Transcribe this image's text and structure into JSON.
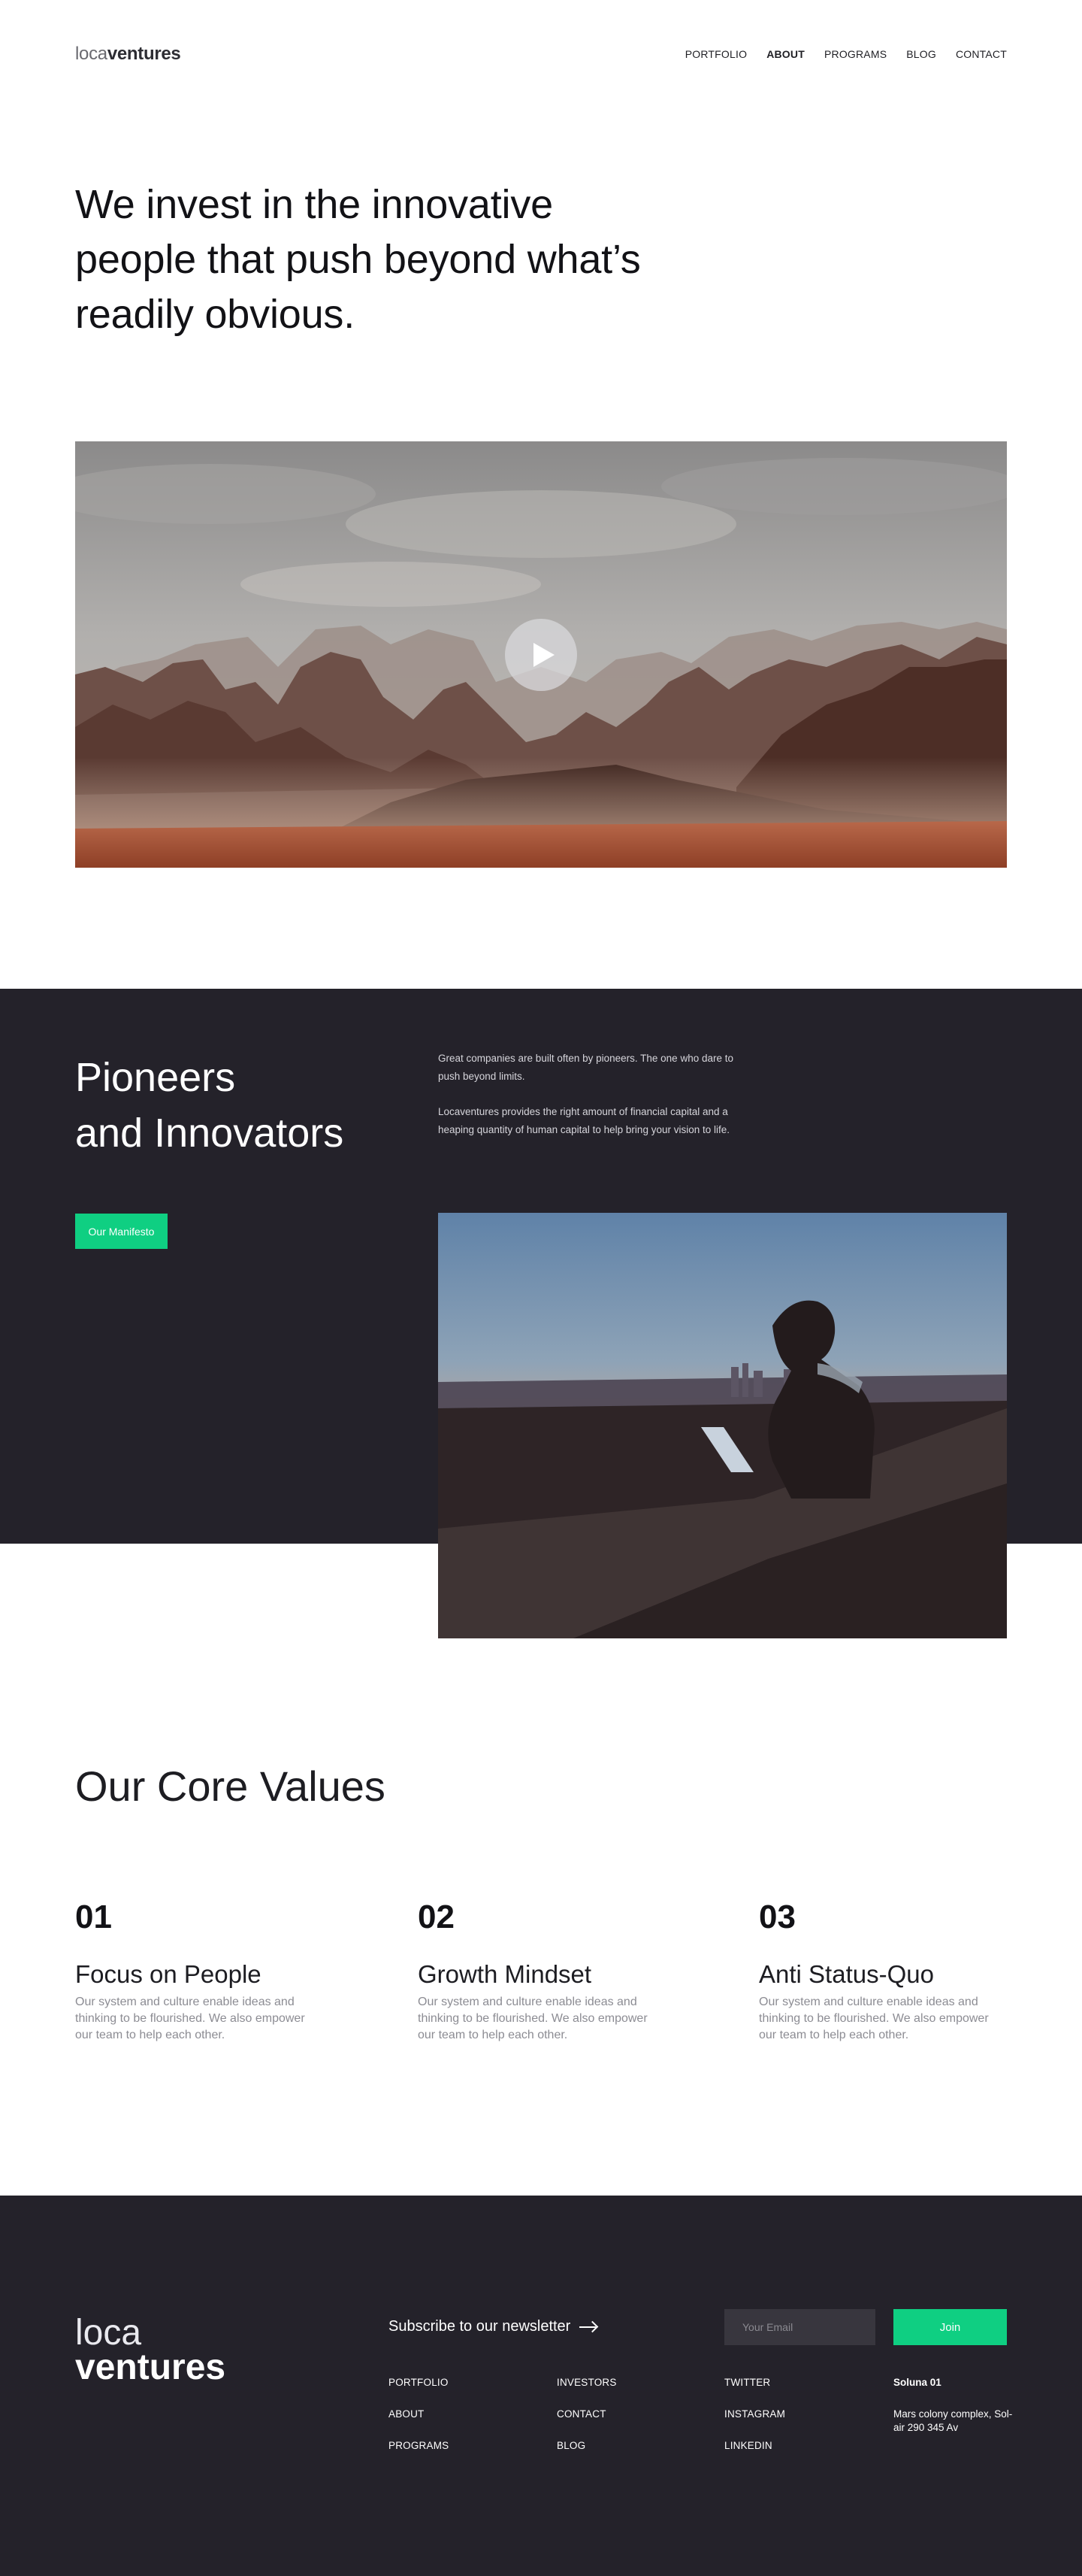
{
  "header": {
    "logo_light": "loca",
    "logo_bold": "ventures",
    "nav": [
      {
        "label": "PORTFOLIO"
      },
      {
        "label": "ABOUT"
      },
      {
        "label": "PROGRAMS"
      },
      {
        "label": "BLOG"
      },
      {
        "label": "CONTACT"
      }
    ],
    "active_nav": "ABOUT"
  },
  "hero": {
    "title": "We invest in the innovative people that push beyond what’s readily obvious.",
    "video_icon": "play-icon"
  },
  "pioneers": {
    "title_line1": "Pioneers",
    "title_line2": "and Innovators",
    "paragraph1": "Great companies are built often by pioneers. The one who dare to push beyond limits.",
    "paragraph2": "Locaventures provides the right amount of financial capital and a heaping quantity of human capital to help bring your vision to life.",
    "button_label": "Our Manifesto"
  },
  "core_values": {
    "title": "Our Core Values",
    "items": [
      {
        "num": "01",
        "title": "Focus on People",
        "desc": "Our system and culture enable ideas and thinking to be flourished. We also empower our team to help each other."
      },
      {
        "num": "02",
        "title": "Growth Mindset",
        "desc": "Our system and culture enable ideas and thinking to be flourished. We also empower our team to help each other."
      },
      {
        "num": "03",
        "title": "Anti Status-Quo",
        "desc": "Our system and culture enable ideas and thinking to be flourished. We also empower our team to help each other."
      }
    ]
  },
  "footer": {
    "logo_light": "loca",
    "logo_bold": "ventures",
    "newsletter_label": "Subscribe to our newsletter",
    "email_placeholder": "Your Email",
    "join_label": "Join",
    "col1": [
      "PORTFOLIO",
      "ABOUT",
      "PROGRAMS"
    ],
    "col2": [
      "INVESTORS",
      "CONTACT",
      "BLOG"
    ],
    "col3": [
      "TWITTER",
      "INSTAGRAM",
      "LINKEDIN"
    ],
    "address_name": "Soluna 01",
    "address_text": "Mars colony complex, Sol-air 290 345 Av"
  },
  "colors": {
    "accent": "#0fcf82",
    "dark_bg": "#24222a",
    "text_dark": "#121216",
    "text_muted": "#8c8c93"
  }
}
